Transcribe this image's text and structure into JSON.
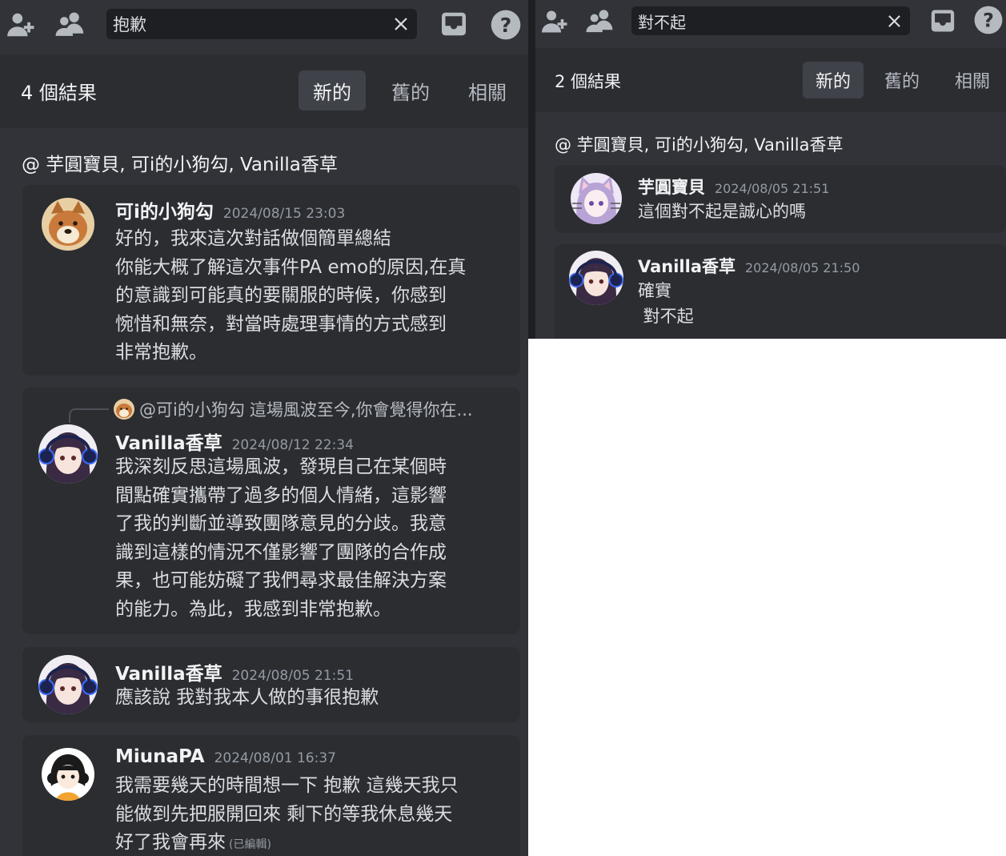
{
  "left": {
    "search_query": "抱歉",
    "result_count": "4 個結果",
    "tabs": [
      "新的",
      "舊的",
      "相關"
    ],
    "channel_line": "@ 芋圓寶貝, 可i的小狗勾, Vanilla香草",
    "messages": [
      {
        "author": "可i的小狗勾",
        "timestamp": "2024/08/15 23:03",
        "lines": [
          "好的，我來這次對話做個簡單總結",
          "你能大概了解這次事件PA emo的原因,在真",
          "的意識到可能真的要關服的時候，你感到",
          "惋惜和無奈，對當時處理事情的方式感到",
          "非常抱歉。"
        ]
      },
      {
        "reply_author": "@可i的小狗勾",
        "reply_text": "這場風波至今,你會覺得你在...",
        "author": "Vanilla香草",
        "timestamp": "2024/08/12 22:34",
        "lines": [
          "我深刻反思這場風波，發現自己在某個時",
          "間點確實攜帶了過多的個人情緒，這影響",
          "了我的判斷並導致團隊意見的分歧。我意",
          "識到這樣的情況不僅影響了團隊的合作成",
          "果，也可能妨礙了我們尋求最佳解決方案",
          "的能力。為此，我感到非常抱歉。"
        ]
      },
      {
        "author": "Vanilla香草",
        "timestamp": "2024/08/05 21:51",
        "lines": [
          "應該說 我對我本人做的事很抱歉"
        ]
      },
      {
        "author": "MiunaPA",
        "timestamp": "2024/08/01 16:37",
        "lines": [
          "我需要幾天的時間想一下 抱歉 這幾天我只",
          "能做到先把服開回來 剩下的等我休息幾天",
          "好了我會再來"
        ],
        "edited": "(已編輯)"
      }
    ]
  },
  "right": {
    "search_query": "對不起",
    "result_count": "2 個結果",
    "tabs": [
      "新的",
      "舊的",
      "相關"
    ],
    "channel_line": "@ 芋圓寶貝, 可i的小狗勾, Vanilla香草",
    "messages": [
      {
        "author": "芋圓寶貝",
        "timestamp": "2024/08/05 21:51",
        "lines": [
          "這個對不起是誠心的嗎"
        ]
      },
      {
        "author": "Vanilla香草",
        "timestamp": "2024/08/05 21:50",
        "lines": [
          "確實",
          " 對不起"
        ]
      }
    ]
  },
  "colors": {
    "background": "#313338",
    "card": "#2b2d31",
    "search_field": "#1e1f22",
    "active_tab": "#404249",
    "text": "#dbdee1",
    "muted": "#949ba4",
    "icon": "#b5bac1"
  },
  "icons": [
    "add-friend-icon",
    "members-icon",
    "close-icon",
    "inbox-icon",
    "help-icon"
  ]
}
